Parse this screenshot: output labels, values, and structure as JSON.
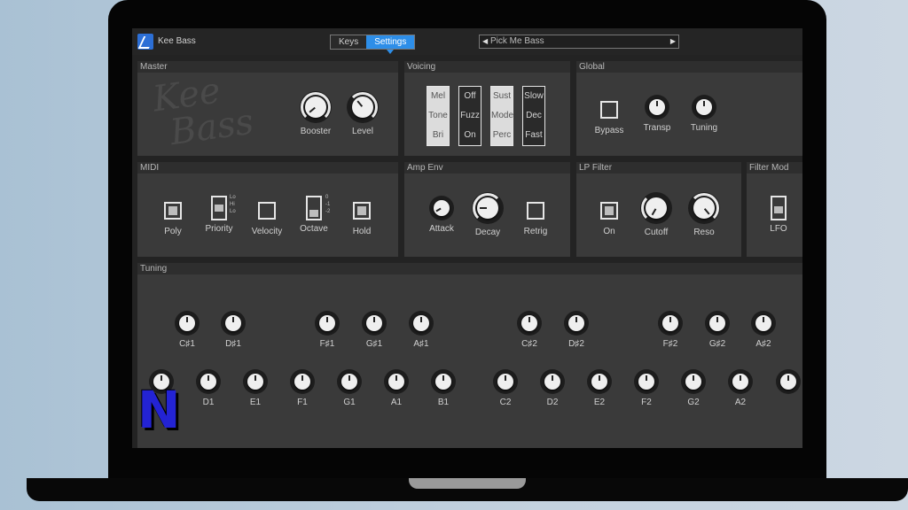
{
  "header": {
    "title": "Kee Bass",
    "tabs": [
      {
        "label": "Keys"
      },
      {
        "label": "Settings"
      }
    ],
    "preset": "Pick Me Bass"
  },
  "master": {
    "title": "Master",
    "logo_line1": "Kee",
    "logo_line2": "Bass",
    "booster": "Booster",
    "level": "Level"
  },
  "voicing": {
    "title": "Voicing",
    "col1": [
      "Mel",
      "Tone",
      "Bri"
    ],
    "col2": [
      "Off",
      "Fuzz",
      "On"
    ],
    "col3": [
      "Sust",
      "Mode",
      "Perc"
    ],
    "col4": [
      "Slow",
      "Dec",
      "Fast"
    ]
  },
  "global": {
    "title": "Global",
    "bypass": "Bypass",
    "transp": "Transp",
    "tuning": "Tuning"
  },
  "midi": {
    "title": "MIDI",
    "poly": "Poly",
    "priority": "Priority",
    "priority_ticks": [
      "Lo",
      "Hi",
      "Lo"
    ],
    "velocity": "Velocity",
    "octave": "Octave",
    "octave_ticks": [
      "0",
      "-1",
      "-2"
    ],
    "hold": "Hold"
  },
  "ampenv": {
    "title": "Amp Env",
    "attack": "Attack",
    "decay": "Decay",
    "retrig": "Retrig"
  },
  "lpfilter": {
    "title": "LP Filter",
    "on": "On",
    "cutoff": "Cutoff",
    "reso": "Reso"
  },
  "filtermod": {
    "title": "Filter Mod",
    "lfo": "LFO"
  },
  "tuning": {
    "title": "Tuning",
    "sharps": [
      "C♯1",
      "D♯1",
      "F♯1",
      "G♯1",
      "A♯1",
      "C♯2",
      "D♯2",
      "F♯2",
      "G♯2",
      "A♯2"
    ],
    "naturals": [
      "",
      "D1",
      "E1",
      "F1",
      "G1",
      "A1",
      "B1",
      "C2",
      "D2",
      "E2",
      "F2",
      "G2",
      "A2",
      ""
    ]
  },
  "badge": "N",
  "colors": {
    "accent": "#2d8ee8",
    "panel": "#3a3a3a",
    "badge": "#2323d4"
  }
}
